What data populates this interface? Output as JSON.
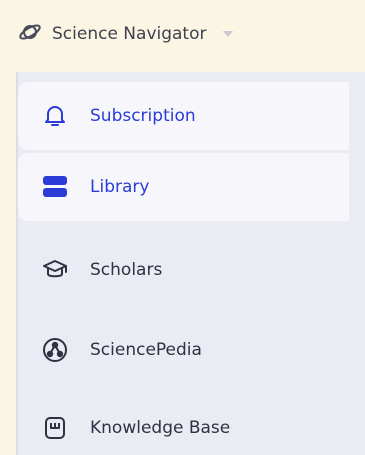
{
  "header": {
    "title": "Science Navigator",
    "icon": "planet-icon"
  },
  "sidebar": {
    "items": [
      {
        "label": "Subscription",
        "icon": "bell-icon",
        "active": true
      },
      {
        "label": "Library",
        "icon": "stack-icon",
        "active": true
      },
      {
        "label": "Scholars",
        "icon": "graduation-cap-icon",
        "active": false
      },
      {
        "label": "SciencePedia",
        "icon": "network-icon",
        "active": false
      },
      {
        "label": "Knowledge Base",
        "icon": "book-icon",
        "active": false
      }
    ]
  },
  "colors": {
    "accent": "#2b3bd6",
    "text": "#2f3242",
    "sidebar_bg": "#ebebf4",
    "active_bg": "#f7f7fb",
    "page_bg": "#fbf6e4"
  }
}
